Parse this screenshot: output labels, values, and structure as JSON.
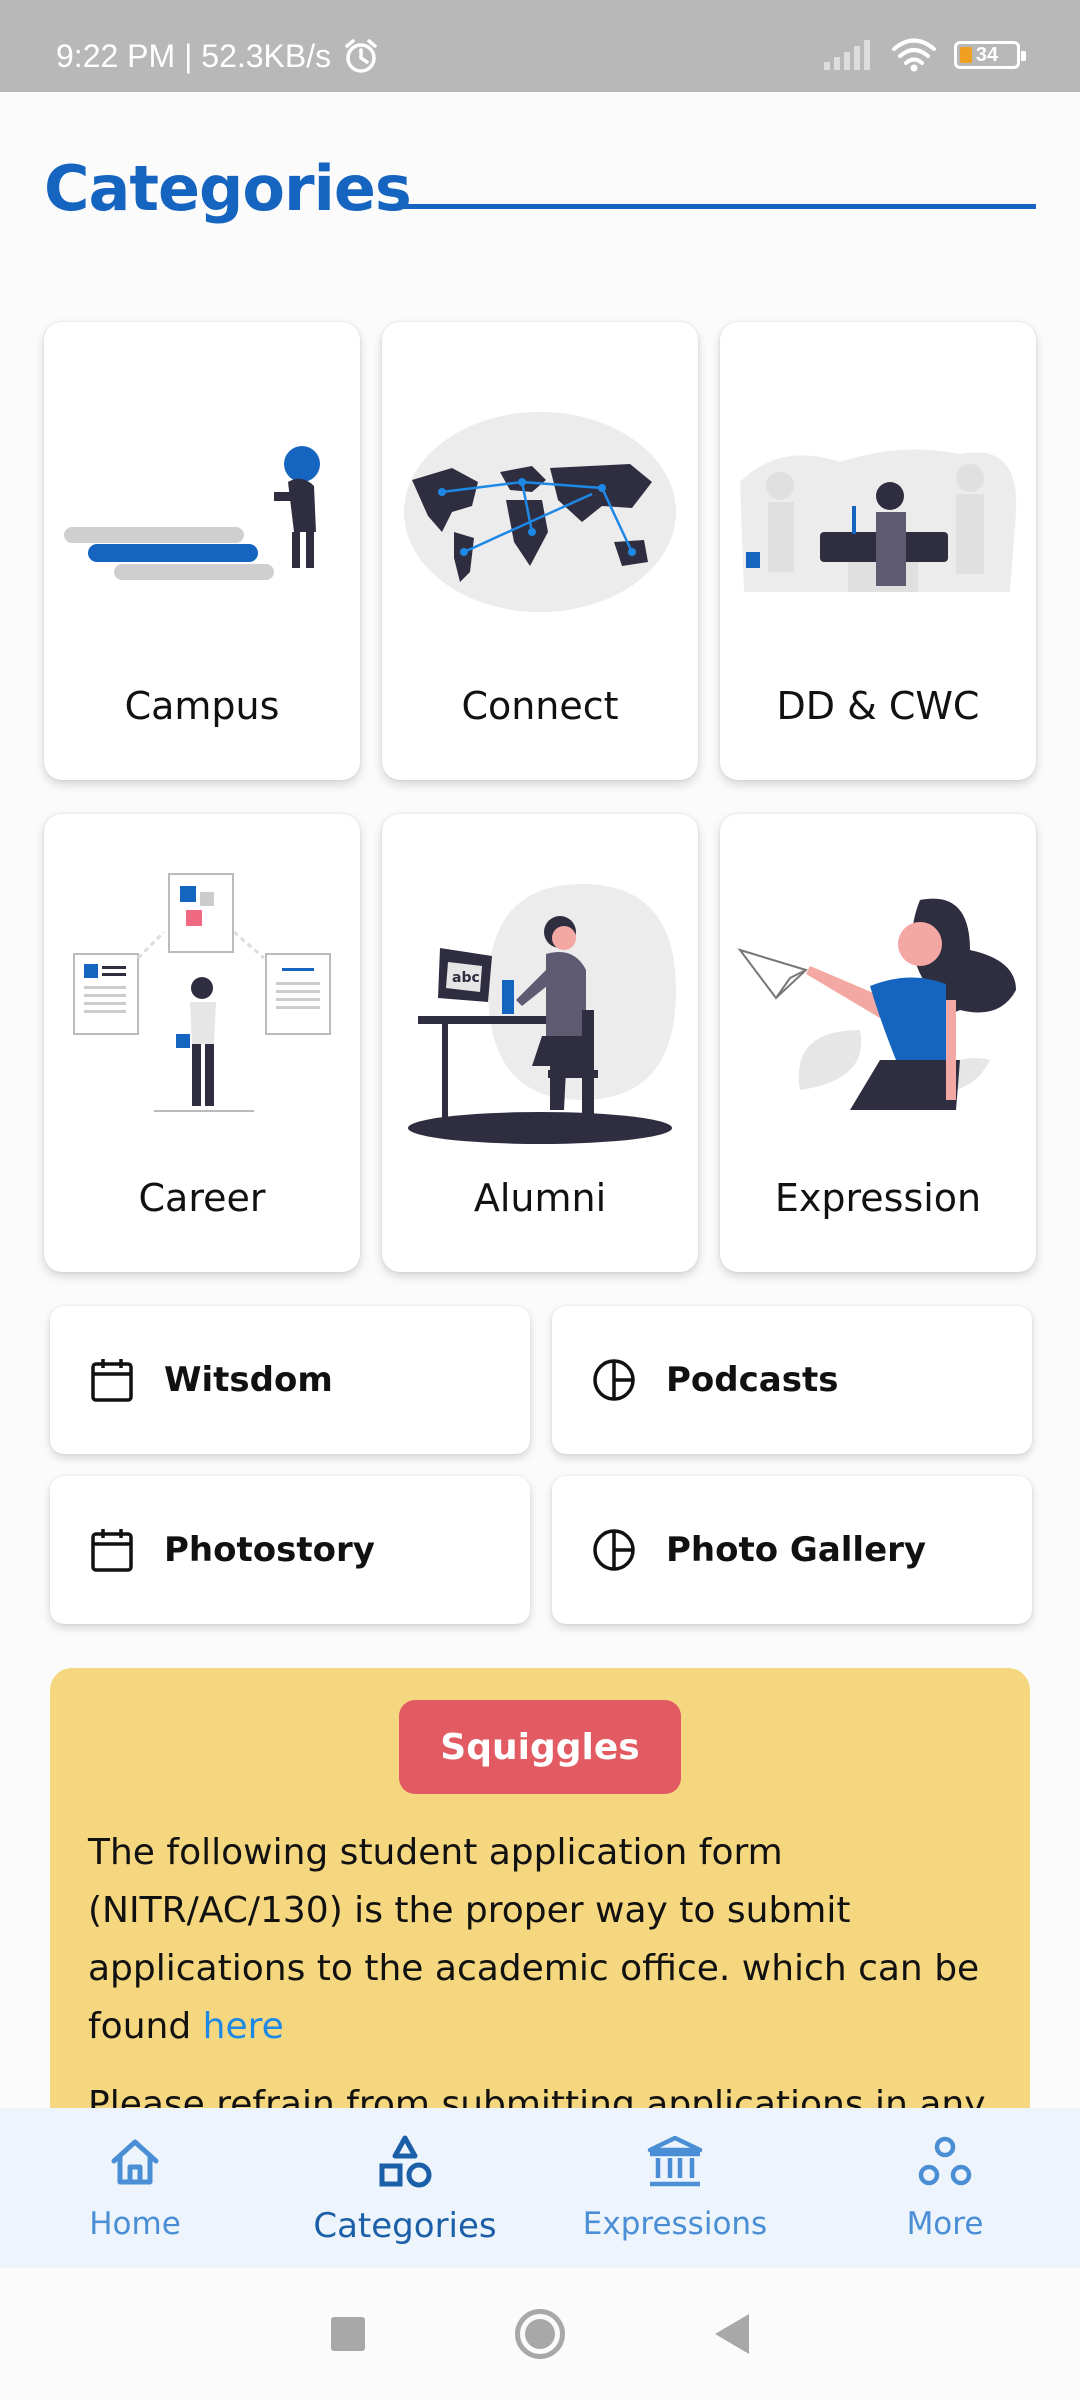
{
  "status_bar": {
    "time_speed": "9:22 PM | 52.3KB/s",
    "battery": "34"
  },
  "header": {
    "title": "Categories"
  },
  "categories": [
    {
      "label": "Campus",
      "icon": "campus-illustration"
    },
    {
      "label": "Connect",
      "icon": "world-map-illustration"
    },
    {
      "label": "DD & CWC",
      "icon": "podium-speaker-illustration"
    },
    {
      "label": "Career",
      "icon": "career-board-illustration"
    },
    {
      "label": "Alumni",
      "icon": "person-at-computer-illustration"
    },
    {
      "label": "Expression",
      "icon": "paper-plane-illustration"
    }
  ],
  "links": [
    {
      "label": "Witsdom",
      "icon": "calendar-icon"
    },
    {
      "label": "Podcasts",
      "icon": "pie-chart-icon"
    },
    {
      "label": "Photostory",
      "icon": "calendar-icon"
    },
    {
      "label": "Photo Gallery",
      "icon": "pie-chart-icon"
    }
  ],
  "squiggles": {
    "badge": "Squiggles",
    "paragraph1": "The following student application form (NITR/AC/130) is the proper way to submit applications to the academic office. which can be found ",
    "link_text": "here",
    "paragraph2": "Please refrain from submitting applications in any other format."
  },
  "bottom_nav": {
    "items": [
      {
        "label": "Home",
        "icon": "home-icon"
      },
      {
        "label": "Categories",
        "icon": "shapes-icon",
        "active": true
      },
      {
        "label": "Expressions",
        "icon": "bank-icon"
      },
      {
        "label": "More",
        "icon": "dots-icon"
      }
    ]
  },
  "colors": {
    "accent": "#1565c0",
    "nav_inactive": "#4a8fd6",
    "squiggles_bg": "#f5d77f",
    "squiggles_badge": "#e35b62"
  }
}
